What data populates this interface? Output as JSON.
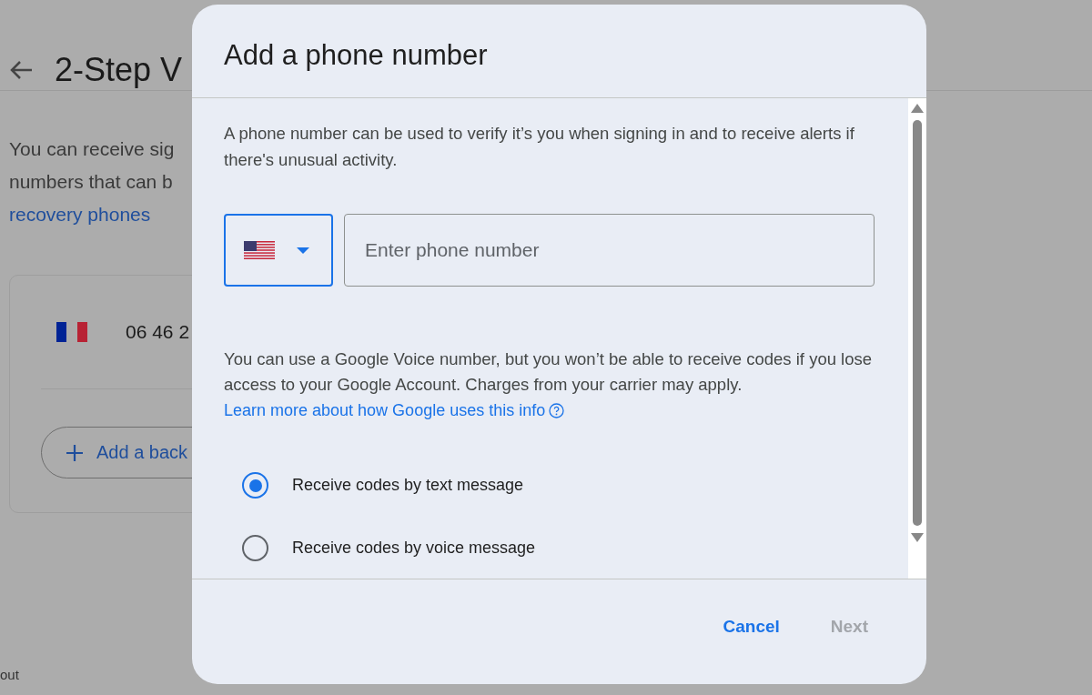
{
  "page": {
    "title": "2-Step V",
    "intro_lines": [
      "You can receive sig",
      "numbers that can b"
    ],
    "intro_link": "recovery phones",
    "phone": {
      "number": "06 46 2"
    },
    "add_button": "Add a back",
    "footer_text": "out"
  },
  "dialog": {
    "title": "Add a phone number",
    "description": "A phone number can be used to verify it’s you when signing in and to receive alerts if there's unusual activity.",
    "country_select": {
      "focused": true
    },
    "phone_field": {
      "placeholder": "Enter phone number"
    },
    "notice": "You can use a Google Voice number, but you won’t be able to receive codes if you lose access to your Google Account. Charges from your carrier may apply.",
    "learn_more": "Learn more about how Google uses this info",
    "options": [
      {
        "label": "Receive codes by text message",
        "selected": true
      },
      {
        "label": "Receive codes by voice message",
        "selected": false
      }
    ],
    "buttons": [
      {
        "label": "Cancel",
        "disabled": false
      },
      {
        "label": "Next",
        "disabled": true
      }
    ]
  }
}
